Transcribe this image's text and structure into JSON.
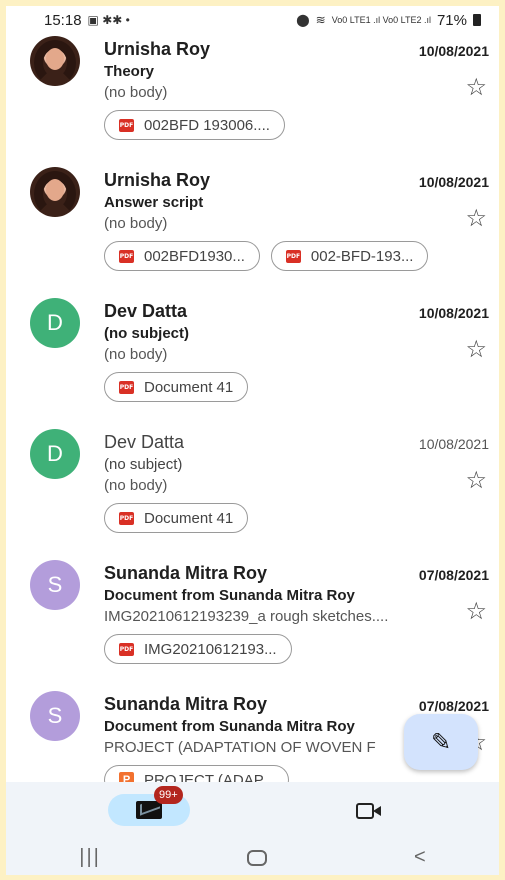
{
  "status_bar": {
    "time": "15:18",
    "left_icons": "▣ ✱✱ •",
    "network": "Vo0 LTE1 .ıl Vo0 LTE2 .ıl",
    "battery": "71%"
  },
  "emails": [
    {
      "sender": "Urnisha Roy",
      "date": "10/08/2021",
      "subject": "Theory",
      "snippet": "(no body)",
      "avatar": "photo",
      "unread": true,
      "attachments": [
        {
          "type": "pdf",
          "name": "002BFD 193006...."
        }
      ]
    },
    {
      "sender": "Urnisha Roy",
      "date": "10/08/2021",
      "subject": "Answer script",
      "snippet": "(no body)",
      "avatar": "photo",
      "unread": true,
      "attachments": [
        {
          "type": "pdf",
          "name": "002BFD1930..."
        },
        {
          "type": "pdf",
          "name": "002-BFD-193..."
        }
      ]
    },
    {
      "sender": "Dev Datta",
      "date": "10/08/2021",
      "subject": "(no subject)",
      "snippet": "(no body)",
      "avatar": "D",
      "avatar_color": "#3fb178",
      "unread": true,
      "attachments": [
        {
          "type": "pdf",
          "name": "Document 41"
        }
      ]
    },
    {
      "sender": "Dev Datta",
      "date": "10/08/2021",
      "subject": "(no subject)",
      "snippet": "(no body)",
      "avatar": "D",
      "avatar_color": "#3fb178",
      "unread": false,
      "attachments": [
        {
          "type": "pdf",
          "name": "Document 41"
        }
      ]
    },
    {
      "sender": "Sunanda Mitra Roy",
      "date": "07/08/2021",
      "subject": "Document from Sunanda Mitra Roy",
      "snippet": "IMG20210612193239_a rough sketches....",
      "avatar": "S",
      "avatar_color": "#b39ddb",
      "unread": true,
      "attachments": [
        {
          "type": "pdf",
          "name": "IMG20210612193..."
        }
      ]
    },
    {
      "sender": "Sunanda Mitra Roy",
      "date": "07/08/2021",
      "subject": "Document from Sunanda Mitra Roy",
      "snippet": "PROJECT (ADAPTATION OF WOVEN F",
      "avatar": "S",
      "avatar_color": "#b39ddb",
      "unread": true,
      "attachments": [
        {
          "type": "ppt",
          "name": "PROJECT (ADAP..."
        }
      ]
    }
  ],
  "icons": {
    "star": "☆",
    "pdf_label": "PDF",
    "ppt_label": "P",
    "compose": "✎",
    "nav_recents": "|||",
    "nav_back": "<"
  },
  "bottom_nav": {
    "mail_badge": "99+"
  },
  "colors": {
    "frame": "#fdf1c4",
    "nav_bg": "#f0f4f9",
    "active_pill": "#c2e7ff",
    "fab_bg": "#d3e3fd",
    "badge": "#b3261e",
    "pdf": "#d93025"
  }
}
